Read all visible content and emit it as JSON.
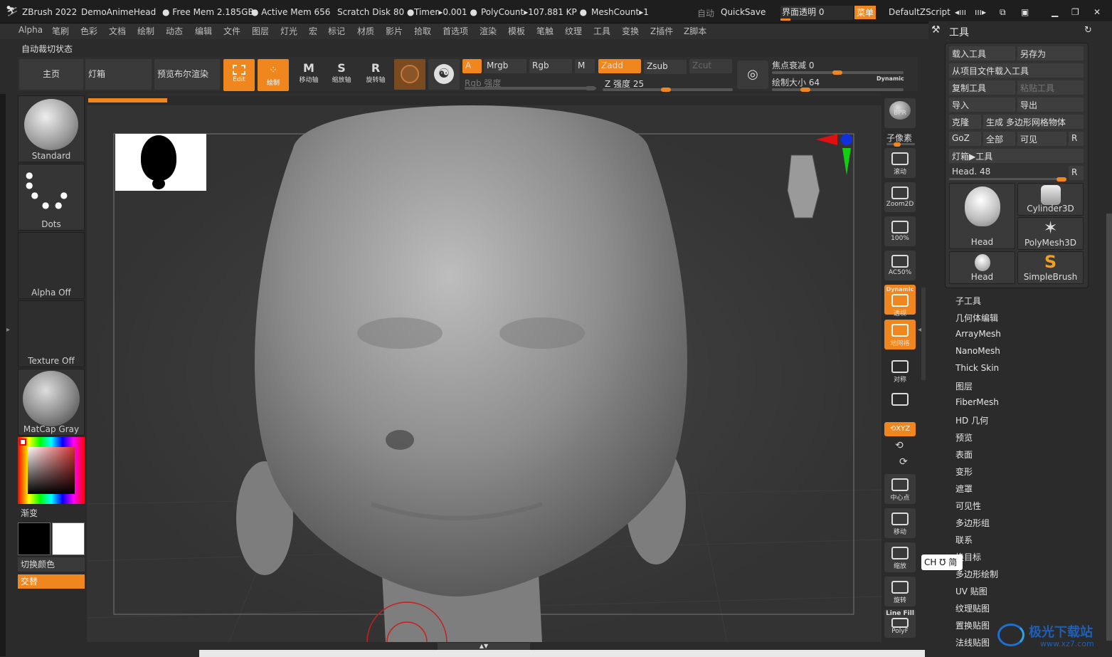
{
  "title_bar": {
    "app": "ZBrush 2022",
    "doc": "DemoAnimeHead",
    "free_mem": "Free Mem 2.185GB",
    "active_mem": "Active Mem 656",
    "scratch": "Scratch Disk 80",
    "timer": "Timer▸0.001",
    "polycount": "PolyCount▸107.881 KP",
    "meshcount": "MeshCount▸1",
    "auto": "自动",
    "quicksave": "QuickSave",
    "transparency": "界面透明 0",
    "menu": "菜单",
    "script": "DefaultZScript"
  },
  "menu": [
    "Alpha",
    "笔刷",
    "色彩",
    "文档",
    "绘制",
    "动态",
    "编辑",
    "文件",
    "图层",
    "灯光",
    "宏",
    "标记",
    "材质",
    "影片",
    "拾取",
    "首选项",
    "渲染",
    "模板",
    "笔触",
    "纹理",
    "工具",
    "变换",
    "Z插件",
    "Z脚本"
  ],
  "subtitle": "自动裁切状态",
  "toolbar": {
    "home": "主页",
    "lightbox": "灯箱",
    "bpr": "预览布尔渲染",
    "edit": "Edit",
    "draw": "绘制",
    "move": "移动轴",
    "scale": "缩放轴",
    "rotate": "旋转轴",
    "a": "A",
    "mrgb": "Mrgb",
    "rgb": "Rgb",
    "m": "M",
    "zadd": "Zadd",
    "zsub": "Zsub",
    "zcut": "Zcut",
    "rgb_intensity": "Rgb 强度",
    "z_intensity": "Z 强度 25",
    "focal": "焦点衰减 0",
    "draw_size": "绘制大小 64",
    "dynamic": "Dynamic",
    "z_intensity_level": 0.25,
    "draw_size_level": 0.16,
    "focal_level": 0.5
  },
  "left_panel": {
    "brush": "Standard",
    "stroke": "Dots",
    "alpha": "Alpha Off",
    "texture": "Texture Off",
    "material": "MatCap Gray",
    "gradient": "渐变",
    "switch_color": "切换颜色",
    "alternate": "交替"
  },
  "right_tools": {
    "bpr": "BPR",
    "subpixel": "子像素",
    "scroll": "滚动",
    "zoom2d": "Zoom2D",
    "zoom100": "100%",
    "ac50": "AC50%",
    "dynamic": "Dynamic",
    "persp": "透视",
    "floor": "地网格",
    "sym": "对称",
    "xyz": "XYZ",
    "center": "中心点",
    "move": "移动",
    "zoom": "缩放",
    "rotate": "旋转",
    "linefill": "Line Fill",
    "polyf": "PolyF"
  },
  "tool_panel": {
    "title": "工具",
    "load": "载入工具",
    "save_as": "另存为",
    "load_from_project": "从项目文件载入工具",
    "copy": "复制工具",
    "paste": "粘贴工具",
    "import": "导入",
    "export": "导出",
    "clone": "克隆",
    "make_polymesh": "生成 多边形网格物体",
    "goz": "GoZ",
    "all": "全部",
    "visible": "可见",
    "r": "R",
    "lightbox_tools": "灯箱▶工具",
    "head_slider": "Head. 48",
    "thumbs": [
      "Head",
      "Cylinder3D",
      "PolyMesh3D",
      "Head",
      "SimpleBrush"
    ],
    "items": [
      "子工具",
      "几何体编辑",
      "ArrayMesh",
      "NanoMesh",
      "Thick Skin",
      "图层",
      "FiberMesh",
      "HD 几何",
      "预览",
      "表面",
      "变形",
      "遮罩",
      "可见性",
      "多边形组",
      "联系",
      "换目标",
      "多边形绘制",
      "UV 贴图",
      "纹理贴图",
      "置换贴图",
      "法线贴图"
    ]
  },
  "ime": "CH ℧ 简",
  "watermark": {
    "cn": "极光下载站",
    "url": "www.xz7.com"
  }
}
